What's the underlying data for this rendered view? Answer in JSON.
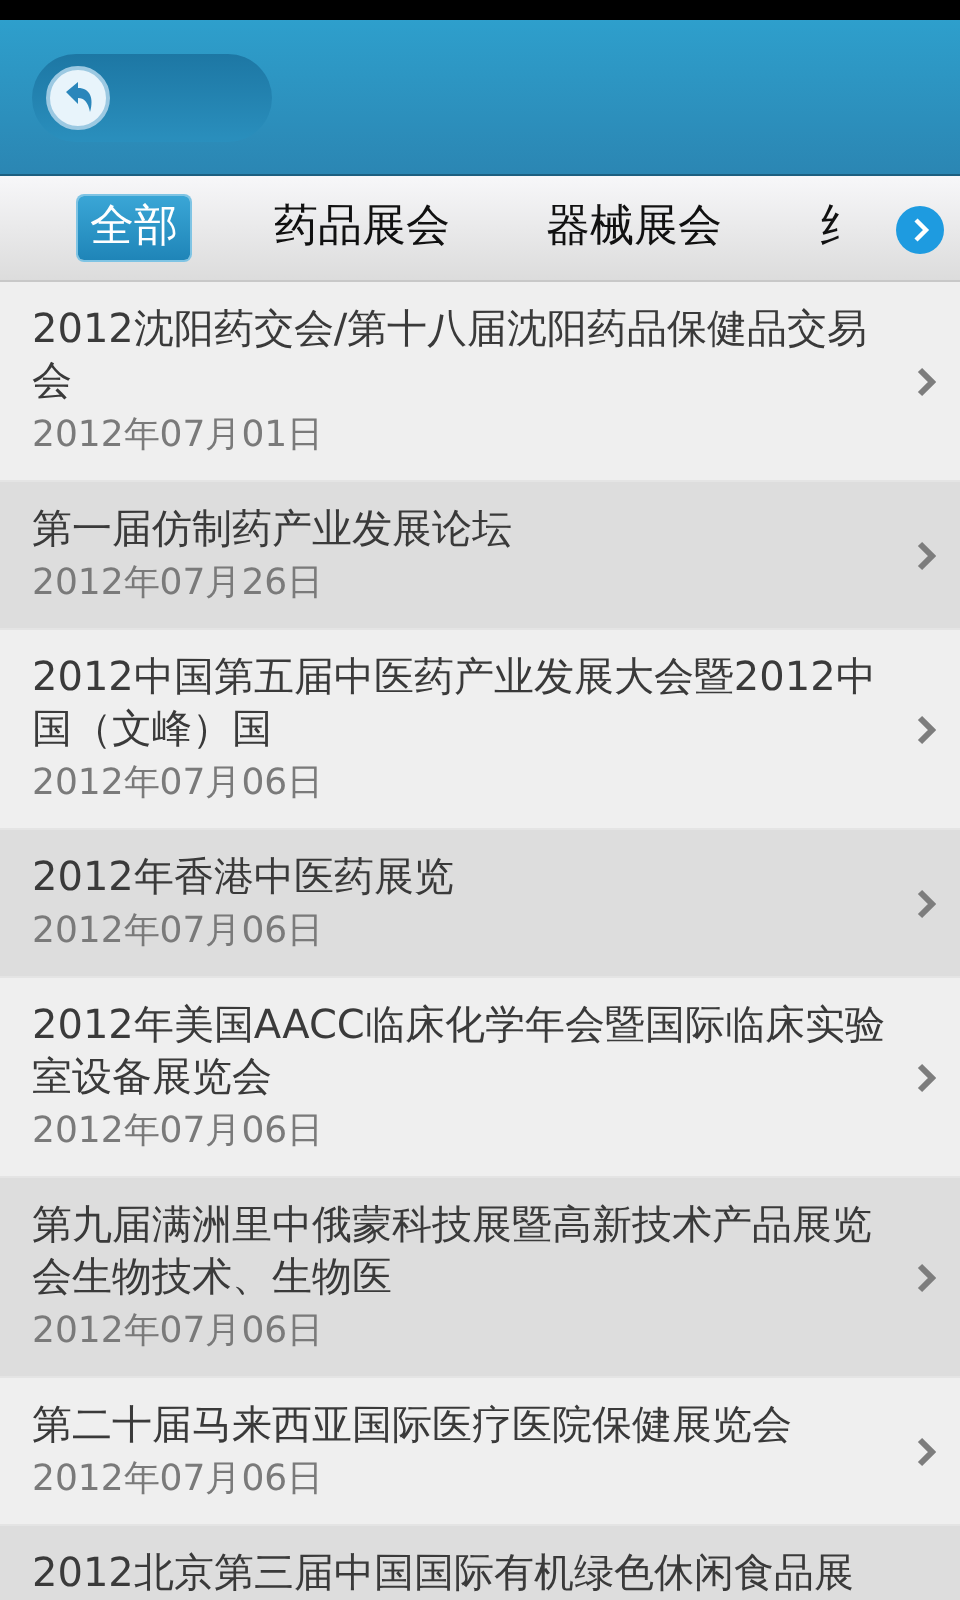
{
  "tabs": [
    {
      "label": "全部",
      "selected": true
    },
    {
      "label": "药品展会",
      "selected": false
    },
    {
      "label": "器械展会",
      "selected": false
    },
    {
      "label": "纟",
      "selected": false
    }
  ],
  "items": [
    {
      "title": "2012沈阳药交会/第十八届沈阳药品保健品交易会",
      "date": "2012年07月01日"
    },
    {
      "title": "第一届仿制药产业发展论坛",
      "date": "2012年07月26日"
    },
    {
      "title": "2012中国第五届中医药产业发展大会暨2012中国（文峰）国",
      "date": "2012年07月06日"
    },
    {
      "title": "2012年香港中医药展览",
      "date": "2012年07月06日"
    },
    {
      "title": "2012年美国AACC临床化学年会暨国际临床实验室设备展览会",
      "date": "2012年07月06日"
    },
    {
      "title": "第九届满洲里中俄蒙科技展暨高新技术产品展览会生物技术、生物医",
      "date": "2012年07月06日"
    },
    {
      "title": "第二十届马来西亚国际医疗医院保健展览会",
      "date": "2012年07月06日"
    },
    {
      "title": "2012北京第三届中国国际有机绿色休闲食品展"
    }
  ]
}
